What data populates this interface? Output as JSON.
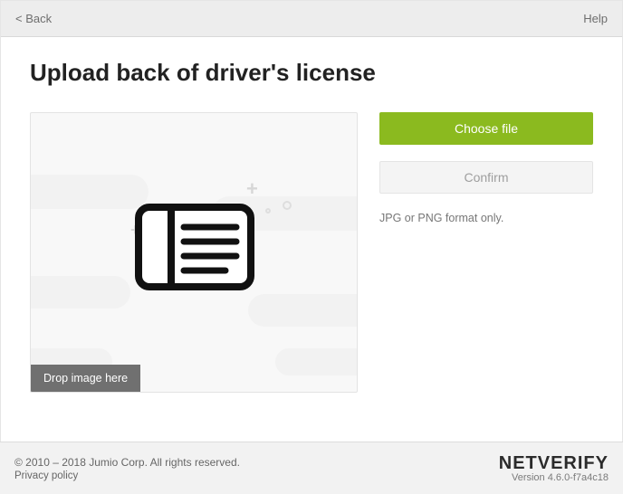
{
  "topbar": {
    "back_label": "< Back",
    "help_label": "Help"
  },
  "title": "Upload back of driver's license",
  "dropzone": {
    "label": "Drop image here",
    "icon": "id-card-back-icon"
  },
  "actions": {
    "choose_file_label": "Choose file",
    "confirm_label": "Confirm"
  },
  "format_hint": "JPG or PNG format only.",
  "footer": {
    "copyright": "© 2010 – 2018 Jumio Corp. All rights reserved.",
    "privacy_label": "Privacy policy",
    "brand": "NETVERIFY",
    "version": "Version 4.6.0-f7a4c18"
  }
}
